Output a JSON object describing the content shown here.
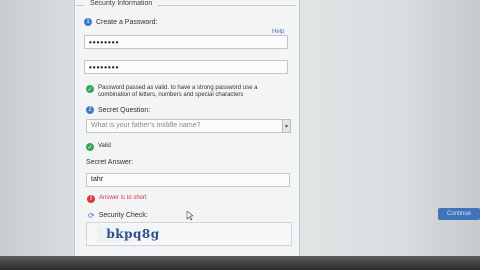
{
  "fieldset": {
    "legend": "Security Information"
  },
  "steps": {
    "create_password": {
      "number": "1",
      "label": "Create a Password:"
    },
    "secret_question": {
      "number": "2",
      "label": "Secret Question:"
    }
  },
  "help_link": "Help",
  "password": {
    "value": "••••••••"
  },
  "confirm_password": {
    "value": "••••••••"
  },
  "password_status": {
    "text": "Password passed as valid. to have a strong password use a combination of letters, numbers and special characters",
    "color": "#3aa35a"
  },
  "secret_question_select": {
    "selected": "What is your father's middle name?"
  },
  "question_status": {
    "text": "Valid",
    "color": "#3aa35a"
  },
  "secret_answer": {
    "label": "Secret Answer:",
    "value": "tahr"
  },
  "answer_error": {
    "text": "Answer is to short",
    "color": "#d63a3a"
  },
  "security_check": {
    "label": "Security Check:",
    "captcha_text": "bkpq8g"
  },
  "side_button": {
    "label": "Continue"
  },
  "icons": {
    "step": "number-badge-icon",
    "ok": "check-circle-icon",
    "error": "error-circle-icon",
    "refresh": "refresh-icon",
    "dropdown": "dropdown-arrow-icon",
    "cursor": "mouse-cursor-icon"
  },
  "colors": {
    "accent": "#3b78c8",
    "button": "#3f74b8"
  }
}
